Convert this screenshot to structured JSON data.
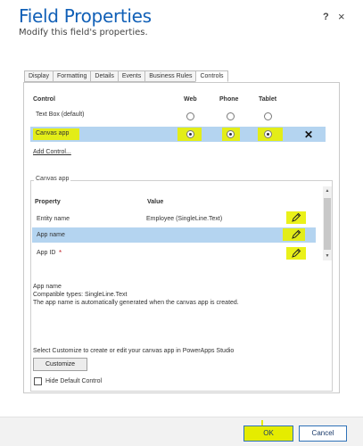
{
  "dialog": {
    "title": "Field Properties",
    "subtitle": "Modify this field's properties.",
    "help": "?",
    "close": "×"
  },
  "tabs": [
    {
      "label": "Display"
    },
    {
      "label": "Formatting"
    },
    {
      "label": "Details"
    },
    {
      "label": "Events"
    },
    {
      "label": "Business Rules"
    },
    {
      "label": "Controls"
    }
  ],
  "controls_table": {
    "headers": {
      "control": "Control",
      "web": "Web",
      "phone": "Phone",
      "tablet": "Tablet"
    },
    "rows": [
      {
        "name": "Text Box (default)",
        "web": false,
        "phone": false,
        "tablet": false,
        "selected": false
      },
      {
        "name": "Canvas app",
        "web": true,
        "phone": true,
        "tablet": true,
        "selected": true
      }
    ],
    "remove": "✕",
    "add_control": "Add Control..."
  },
  "canvas_app": {
    "legend": "Canvas app",
    "headers": {
      "property": "Property",
      "value": "Value"
    },
    "rows": [
      {
        "property": "Entity name",
        "value": "Employee (SingleLine.Text)",
        "required": false,
        "selected": false
      },
      {
        "property": "App name",
        "value": "",
        "required": false,
        "selected": true
      },
      {
        "property": "App ID",
        "value": "",
        "required": true,
        "selected": false
      }
    ],
    "required_mark": "*",
    "info": {
      "name": "App name",
      "types": "Compatible types: SingleLine.Text",
      "description": "The app name is automatically generated when the canvas app is created."
    },
    "customize_hint": "Select Customize to create or edit your canvas app in PowerApps Studio",
    "customize_button": "Customize",
    "hide_default_label": "Hide Default Control",
    "hide_default_checked": false
  },
  "footer": {
    "ok": "OK",
    "cancel": "Cancel"
  },
  "colors": {
    "title": "#1160b7",
    "selected_row": "#b4d4f0",
    "highlight": "#e8f000",
    "button_border": "#2f72b8"
  },
  "icons": {
    "scroll_up": "triangle-up",
    "scroll_down": "triangle-down",
    "edit": "pencil-icon"
  }
}
